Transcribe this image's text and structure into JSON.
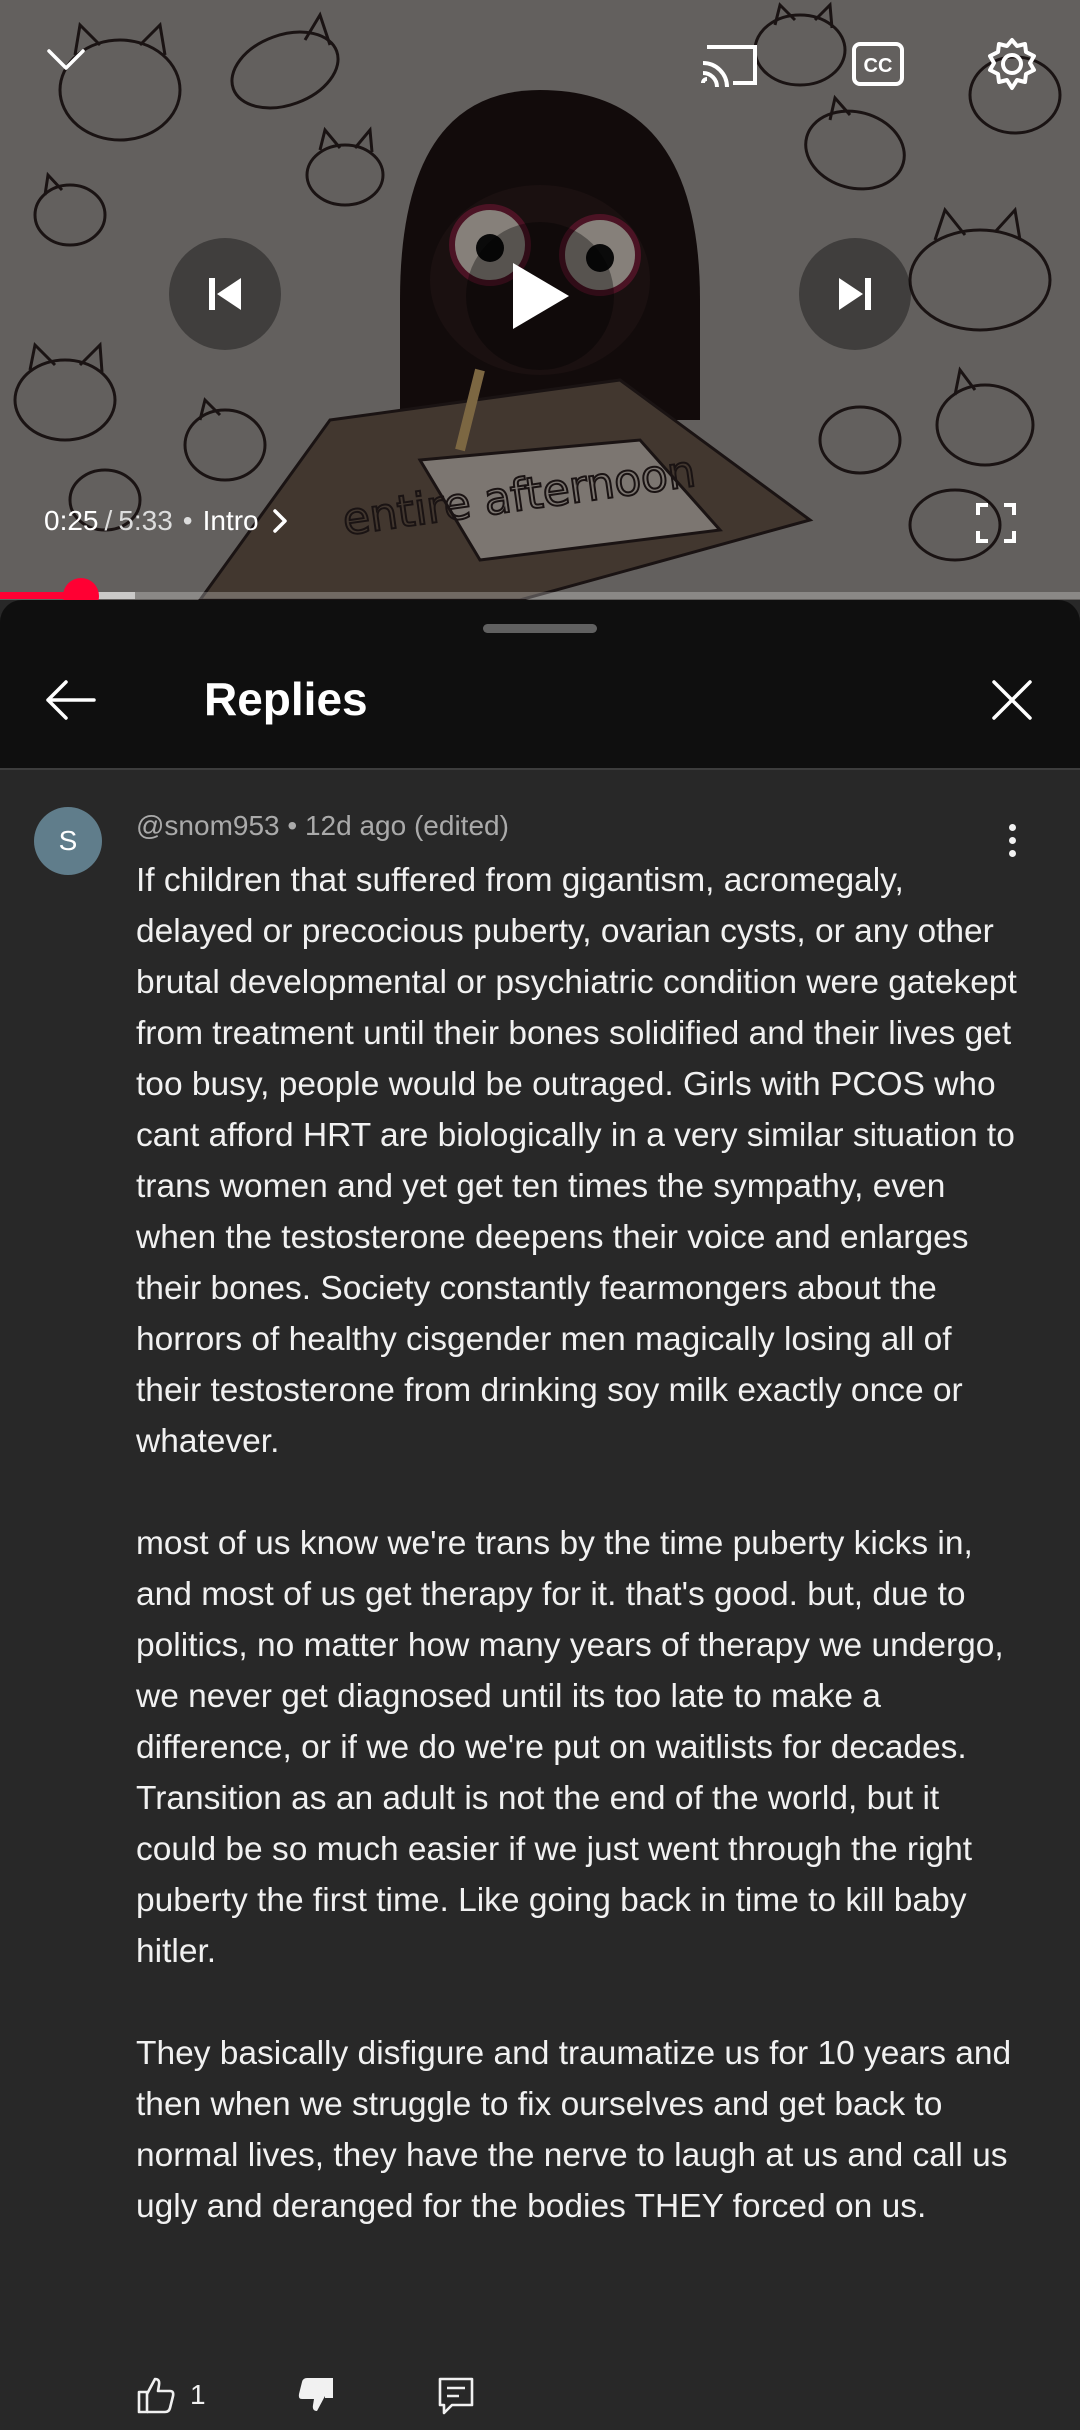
{
  "player": {
    "time_current": "0:25",
    "time_separator": "/",
    "time_total": "5:33",
    "chapter_dot": "•",
    "chapter": "Intro",
    "progress_fraction": 0.075,
    "buffered_fraction": 0.125,
    "accent": "#ff0033",
    "icons": [
      "collapse-chevron-icon",
      "cast-icon",
      "captions-icon",
      "settings-gear-icon",
      "previous-icon",
      "play-icon",
      "next-icon",
      "fullscreen-icon"
    ]
  },
  "captions_label": "CC",
  "sheet": {
    "title": "Replies",
    "back_icon": "arrow-left-icon",
    "close_icon": "close-icon"
  },
  "comment": {
    "avatar_letter": "S",
    "avatar_color": "#607d8b",
    "author": "@snom953",
    "age": "12d ago (edited)",
    "paragraphs": [
      "If children that suffered from gigantism, acromegaly, delayed or precocious puberty, ovarian cysts, or any other brutal developmental or psychiatric condition were gatekept from treatment until their bones solidified and their lives get too busy, people would be outraged.  Girls with PCOS who cant afford HRT are biologically in a very similar situation to trans women and yet get ten times the sympathy, even when the testosterone deepens their voice and enlarges their bones.  Society constantly fearmongers about the horrors of healthy cisgender men magically losing all of their testosterone from drinking soy milk exactly once or whatever.",
      "most of us know we're trans by the time puberty kicks in, and most of us get therapy for it. that's good. but, due to politics, no matter how many years of therapy we undergo, we never get diagnosed until  its too late to make a difference, or if we do we're put on waitlists for decades. Transition as an adult is not the end of the world, but it could be so much easier if we just went through the right puberty the first  time. Like going back in time to  kill baby hitler.",
      "They basically disfigure and traumatize us for 10 years and then when we struggle to fix ourselves and get back to normal lives, they have the nerve to laugh at us and call us ugly and deranged for the bodies THEY forced on us."
    ],
    "like_count": "1",
    "action_icons": [
      "thumbs-up-icon",
      "thumbs-down-icon",
      "reply-icon"
    ]
  }
}
